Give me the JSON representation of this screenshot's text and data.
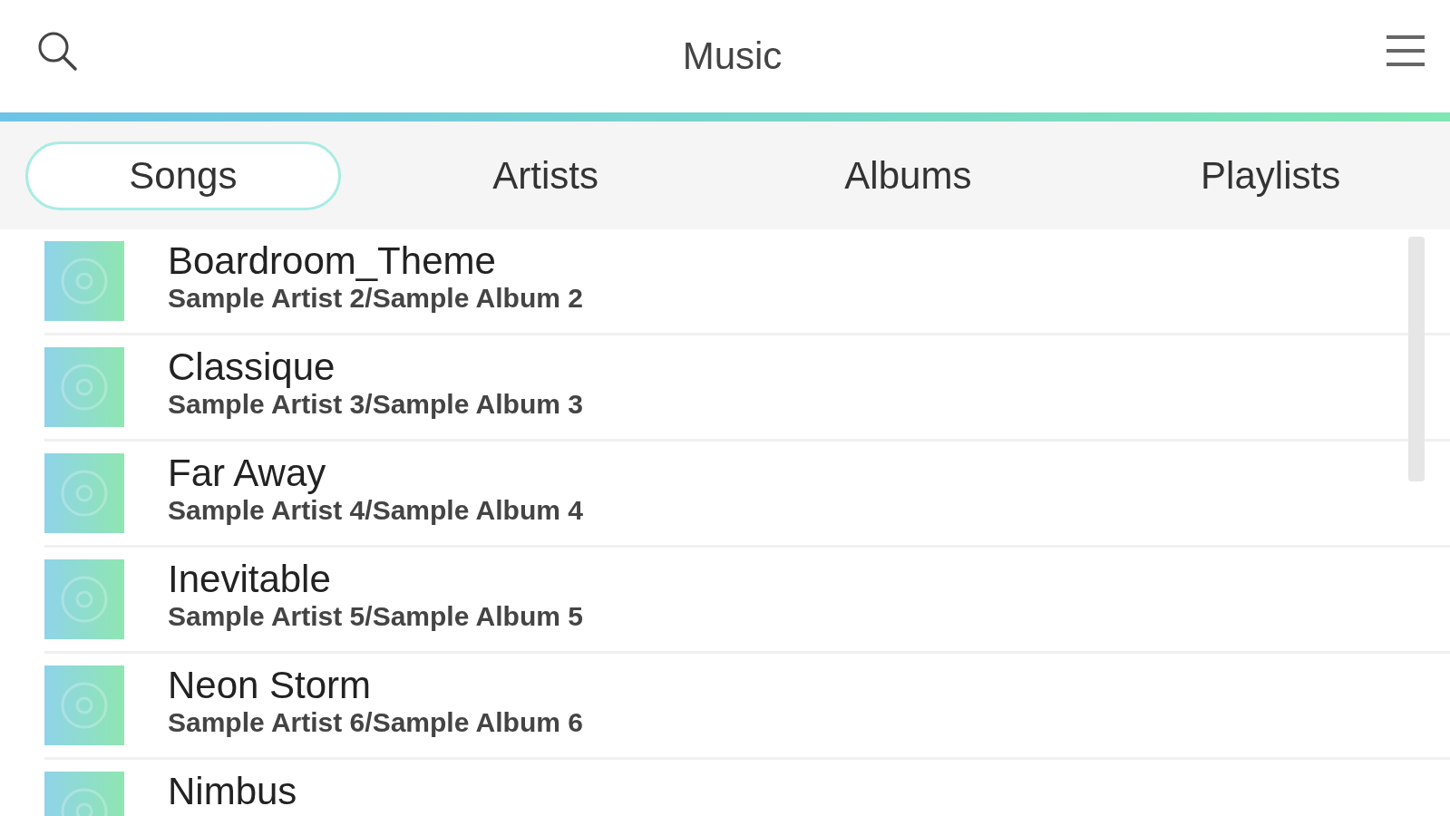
{
  "header": {
    "title": "Music"
  },
  "tabs": [
    {
      "label": "Songs",
      "selected": true
    },
    {
      "label": "Artists",
      "selected": false
    },
    {
      "label": "Albums",
      "selected": false
    },
    {
      "label": "Playlists",
      "selected": false
    }
  ],
  "songs": [
    {
      "title": "Boardroom_Theme",
      "subtitle": "Sample Artist 2/Sample Album 2"
    },
    {
      "title": "Classique",
      "subtitle": "Sample Artist 3/Sample Album 3"
    },
    {
      "title": "Far Away",
      "subtitle": "Sample Artist 4/Sample Album 4"
    },
    {
      "title": "Inevitable",
      "subtitle": "Sample Artist 5/Sample Album 5"
    },
    {
      "title": "Neon Storm",
      "subtitle": "Sample Artist 6/Sample Album 6"
    },
    {
      "title": "Nimbus"
    }
  ]
}
